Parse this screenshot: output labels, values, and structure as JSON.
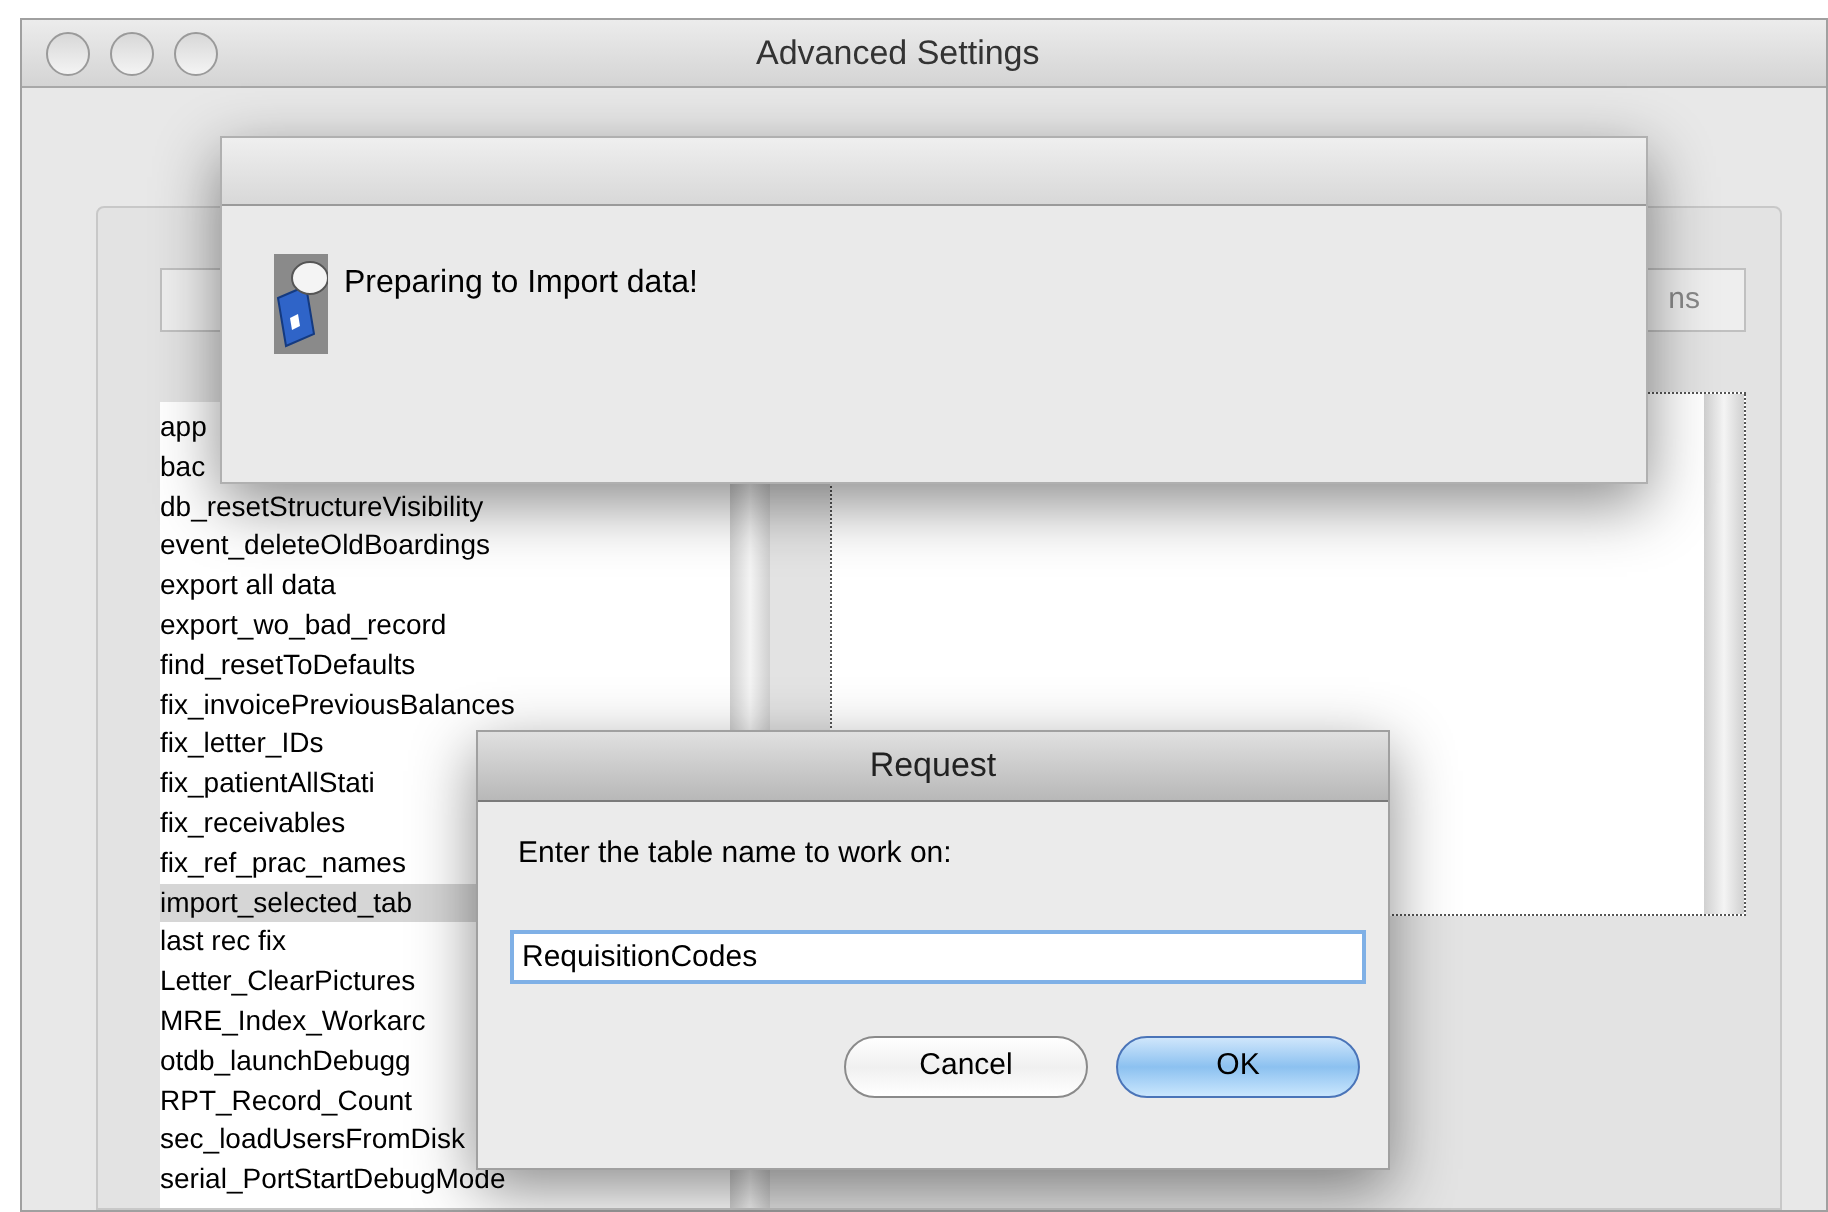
{
  "window": {
    "title": "Advanced Settings"
  },
  "toolbar": {
    "right_button": "ns"
  },
  "methods": [
    {
      "label": "app",
      "selected": false
    },
    {
      "label": "bac",
      "selected": false
    },
    {
      "label": "db_resetStructureVisibility",
      "selected": false
    },
    {
      "label": "event_deleteOldBoardings",
      "selected": false
    },
    {
      "label": "export all data",
      "selected": false
    },
    {
      "label": "export_wo_bad_record",
      "selected": false
    },
    {
      "label": "find_resetToDefaults",
      "selected": false
    },
    {
      "label": "fix_invoicePreviousBalances",
      "selected": false
    },
    {
      "label": "fix_letter_IDs",
      "selected": false
    },
    {
      "label": "fix_patientAllStati",
      "selected": false
    },
    {
      "label": "fix_receivables",
      "selected": false
    },
    {
      "label": "fix_ref_prac_names",
      "selected": false
    },
    {
      "label": "import_selected_tab",
      "selected": true
    },
    {
      "label": "last rec fix",
      "selected": false
    },
    {
      "label": "Letter_ClearPictures",
      "selected": false
    },
    {
      "label": "MRE_Index_Workarc",
      "selected": false
    },
    {
      "label": "otdb_launchDebugg",
      "selected": false
    },
    {
      "label": "RPT_Record_Count",
      "selected": false
    },
    {
      "label": "sec_loadUsersFromDisk",
      "selected": false
    },
    {
      "label": "serial_PortStartDebugMode",
      "selected": false
    }
  ],
  "progress_dialog": {
    "message": "Preparing to Import data!"
  },
  "request_dialog": {
    "title": "Request",
    "prompt": "Enter the table name to work on:",
    "value": "RequisitionCodes",
    "buttons": [
      {
        "label": "Cancel",
        "kind": "normal"
      },
      {
        "label": "OK",
        "kind": "default"
      }
    ]
  }
}
